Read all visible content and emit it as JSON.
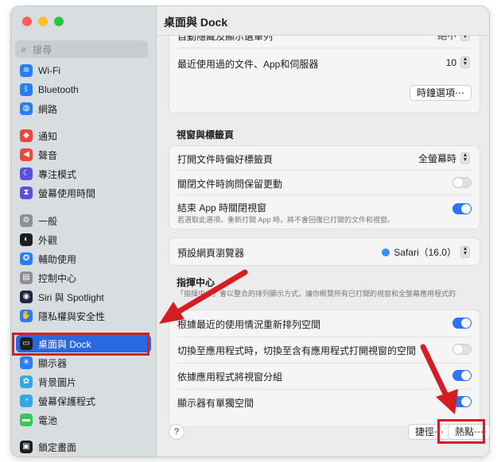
{
  "window": {
    "title": "桌面與 Dock"
  },
  "sidebar": {
    "search_placeholder": "搜尋",
    "items": [
      {
        "label": "Wi-Fi",
        "icon": "wifi-icon",
        "color": "#2a7ef5"
      },
      {
        "label": "Bluetooth",
        "icon": "bluetooth-icon",
        "color": "#2a7ef5"
      },
      {
        "label": "網路",
        "icon": "globe-icon",
        "color": "#2a7ef5"
      },
      {
        "label": "通知",
        "icon": "bell-icon",
        "color": "#f0453a"
      },
      {
        "label": "聲音",
        "icon": "speaker-icon",
        "color": "#f0453a"
      },
      {
        "label": "專注模式",
        "icon": "moon-icon",
        "color": "#5b4fdb"
      },
      {
        "label": "螢幕使用時間",
        "icon": "hourglass-icon",
        "color": "#5b4fdb"
      },
      {
        "label": "一般",
        "icon": "gear-icon",
        "color": "#8e8e93"
      },
      {
        "label": "外觀",
        "icon": "appearance-icon",
        "color": "#1d1d1f"
      },
      {
        "label": "輔助使用",
        "icon": "accessibility-icon",
        "color": "#2a7ef5"
      },
      {
        "label": "控制中心",
        "icon": "control-center-icon",
        "color": "#8e8e93"
      },
      {
        "label": "Siri 與 Spotlight",
        "icon": "siri-icon",
        "color": "#222244"
      },
      {
        "label": "隱私權與安全性",
        "icon": "hand-icon",
        "color": "#2a7ef5"
      },
      {
        "label": "桌面與 Dock",
        "icon": "dock-icon",
        "color": "#1d1d1f"
      },
      {
        "label": "顯示器",
        "icon": "sun-icon",
        "color": "#2a7ef5"
      },
      {
        "label": "背景圖片",
        "icon": "flower-icon",
        "color": "#35a7e8"
      },
      {
        "label": "螢幕保護程式",
        "icon": "screensaver-icon",
        "color": "#35a7e8"
      },
      {
        "label": "電池",
        "icon": "battery-icon",
        "color": "#34c759"
      },
      {
        "label": "鎖定畫面",
        "icon": "lock-screen-icon",
        "color": "#1d1d1f"
      }
    ]
  },
  "content": {
    "card1": {
      "row_cut_label": "自動隱藏及顯示選單列",
      "row_cut_value": "絕不",
      "recent_label": "最近使用過的文件、App和伺服器",
      "recent_value": "10",
      "clock_button": "時鐘選項⋯"
    },
    "windows_section": {
      "title": "視窗與標籤頁",
      "prefer_tabs_label": "打開文件時偏好標籤頁",
      "prefer_tabs_value": "全螢幕時",
      "ask_keep_label": "關閉文件時詢問保留更動",
      "close_windows_label": "結束 App 時關閉視窗",
      "close_windows_sub": "若選取此選項，重新打開 App 時，將不會回復已打開的文件和視窗。"
    },
    "browser": {
      "label": "預設網頁瀏覽器",
      "value": "Safari（16.0）"
    },
    "mission_control": {
      "title": "指揮中心",
      "subtitle": "「指揮中心」會以整合的排列顯示方式，讓你概覽所有已打開的視窗和全螢幕應用程式的",
      "rows": [
        {
          "label": "根據最近的使用情況重新排列空間",
          "on": true
        },
        {
          "label": "切換至應用程式時，切換至含有應用程式打開視窗的空間",
          "on": false
        },
        {
          "label": "依據應用程式將視窗分組",
          "on": true
        },
        {
          "label": "顯示器有單獨空間",
          "on": true
        }
      ]
    },
    "footer": {
      "help": "?",
      "shortcuts_button": "捷徑⋯",
      "hot_corners_button": "熱點⋯"
    }
  },
  "colors": {
    "accent": "#2968e0",
    "toggle_on": "#2b75f6",
    "highlight": "#d61d26"
  }
}
